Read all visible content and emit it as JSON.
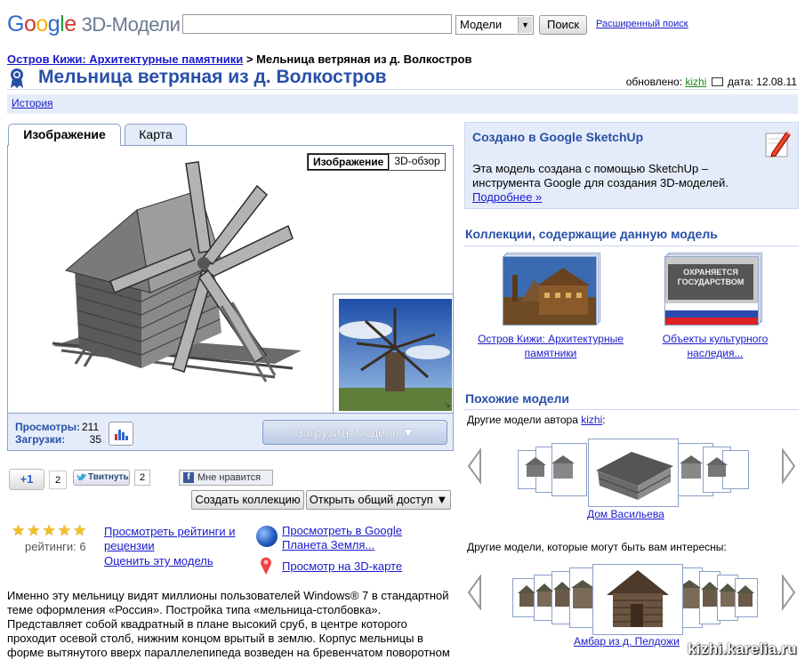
{
  "header": {
    "logo_letters": [
      "G",
      "o",
      "o",
      "g",
      "l",
      "e"
    ],
    "product": "3D-Модели",
    "search_value": "",
    "scope_value": "Модели",
    "search_button": "Поиск",
    "advanced_search": "Расширенный поиск"
  },
  "breadcrumb": {
    "parent": "Остров Кижи: Архитектурные памятники",
    "separator": " > ",
    "current": "Мельница ветряная из д. Волкостров"
  },
  "page_title": "Мельница ветряная из д. Волкостров",
  "updated": {
    "label": "обновлено:",
    "author": "kizhi",
    "date_label": "дата:",
    "date": "12.08.11"
  },
  "history_link": "История",
  "viewer": {
    "tabs": [
      "Изображение",
      "Карта"
    ],
    "toggle": [
      "Изображение",
      "3D-обзор"
    ]
  },
  "stats": {
    "views_label": "Просмотры:",
    "views": "211",
    "downloads_label": "Загрузки:",
    "downloads": "35",
    "download_button": "Загрузить модель ▼"
  },
  "social": {
    "plusone": "+1",
    "plusone_count": "2",
    "tweet": "Твитнуть",
    "tweet_count": "2",
    "like": "Мне нравится",
    "create_collection": "Создать коллекцию",
    "share": "Открыть общий доступ ▼"
  },
  "ratings": {
    "stars": 5,
    "count_label": "рейтинги: 6",
    "view_ratings": "Просмотреть рейтинги и рецензии",
    "rate": "Оценить эту модель",
    "view_earth": "Просмотреть в Google Планета Земля...",
    "view_map": "Просмотр на 3D-карте"
  },
  "description": "Именно эту мельницу видят миллионы пользователей Windows® 7 в стандартной теме оформления «Россия». Постройка типа «мельница-столбовка». Представляет собой квадратный в плане высокий сруб, в центре которого проходит осевой столб, нижним концом врытый в землю. Корпус мельницы в форме вытянутого вверх параллелепипеда возведен на бревенчатом поворотном кругу —",
  "sketchup": {
    "title": "Создано в Google SketchUp",
    "text": "Эта модель создана с помощью SketchUp – инструмента Google для создания 3D-моделей.",
    "more": "Подробнее »"
  },
  "collections": {
    "title": "Коллекции, содержащие данную модель",
    "items": [
      {
        "name": "Остров Кижи: Архитектурные памятники"
      },
      {
        "name": "Объекты культурного наследия...",
        "image_text": "ОХРАНЯЕТСЯ ГОСУДАРСТВОМ"
      }
    ]
  },
  "similar": {
    "title": "Похожие модели",
    "by_author_prefix": "Другие модели автора ",
    "author": "kizhi",
    "by_author_suffix": ":",
    "model1": "Дом Васильева",
    "others_label": "Другие модели, которые могут быть вам интересны:",
    "model2": "Амбар из д. Пелдожи"
  },
  "watermark": "kizhi.karelia.ru",
  "colors": {
    "link": "#1a1acc",
    "title_blue": "#2850a8",
    "panel_bg": "#e5ecf9",
    "border": "#8aa0c8"
  }
}
